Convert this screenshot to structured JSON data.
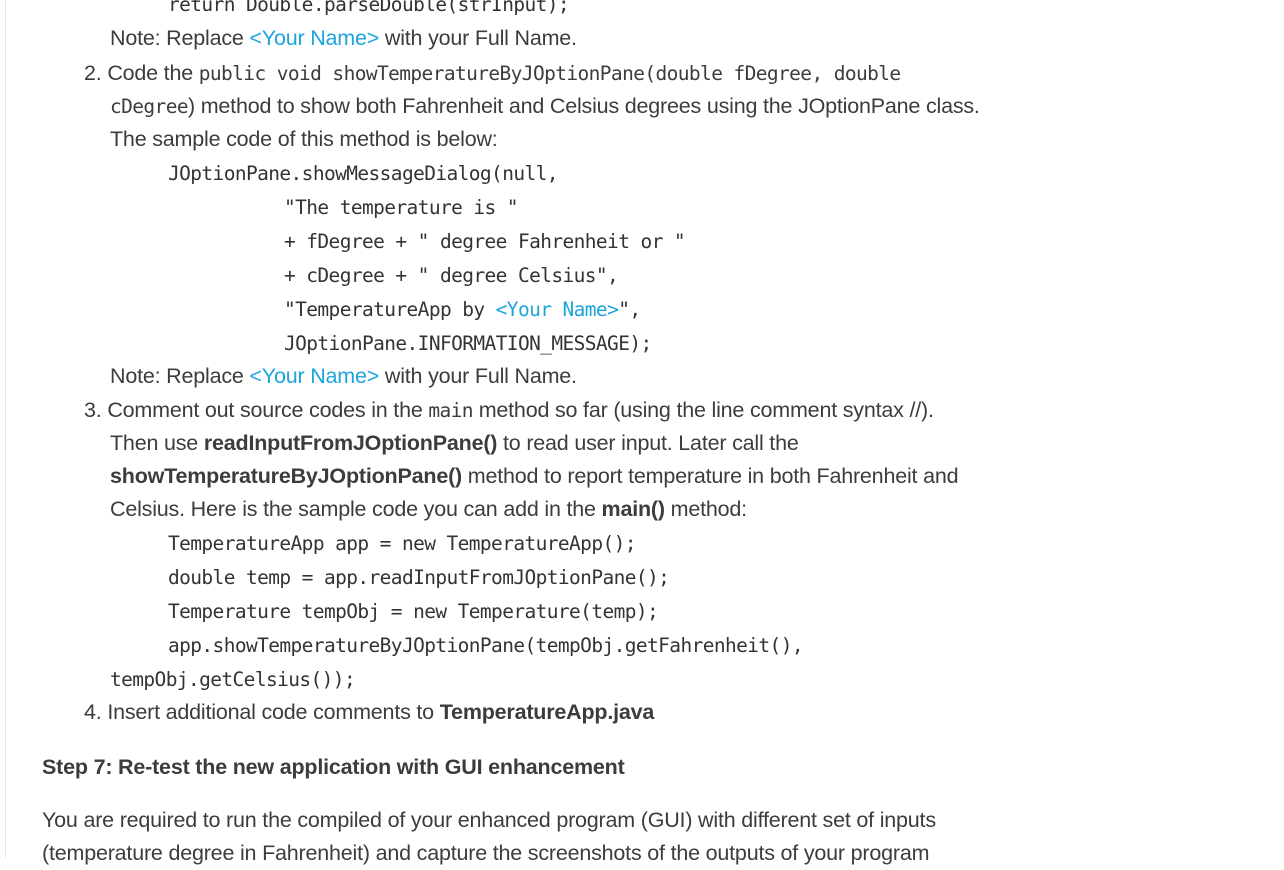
{
  "accent_color": "#1ea4dc",
  "doc": {
    "code_return": "return Double.parseDouble(strInput);",
    "note1": {
      "pre": "Note: Replace ",
      "link": "<Your Name>",
      "post": " with your Full Name."
    },
    "item2": {
      "number": "2.",
      "pre": "Code the ",
      "code1": "public void showTemperatureByJOptionPane(double fDegree, double",
      "code2": "cDegree",
      "post": ") method to show both Fahrenheit and Celsius degrees using the JOptionPane class.",
      "line3": "The sample code of this method is below:"
    },
    "code_block1": {
      "l1": "JOptionPane.showMessageDialog(null,",
      "l2": "\"The temperature is \"",
      "l3": "+ fDegree + \" degree Fahrenheit or \"",
      "l4": "+ cDegree + \" degree Celsius\",",
      "l5_pre": "\"TemperatureApp by ",
      "l5_link": "<Your Name>",
      "l5_post": "\",",
      "l6": "JOptionPane.INFORMATION_MESSAGE);"
    },
    "note2": {
      "pre": "Note: Replace ",
      "link": "<Your Name>",
      "post": " with your Full Name."
    },
    "item3": {
      "number": "3.",
      "l1_pre": "Comment out source codes in the ",
      "l1_code": "main",
      "l1_post": " method so far (using the line comment syntax //).",
      "l2_pre": "Then use ",
      "l2_bold": "readInputFromJOptionPane()",
      "l2_post": " to read user input. Later call the",
      "l3_bold": "showTemperatureByJOptionPane()",
      "l3_post": " method to report temperature in both Fahrenheit and",
      "l4_pre": "Celsius. Here is the sample code you can add in the ",
      "l4_bold": "main()",
      "l4_post": " method:"
    },
    "code_block2": {
      "l1": "TemperatureApp app = new TemperatureApp();",
      "l2": "double temp = app.readInputFromJOptionPane();",
      "l3": "Temperature tempObj = new Temperature(temp);",
      "l4": "app.showTemperatureByJOptionPane(tempObj.getFahrenheit(),",
      "l5": "tempObj.getCelsius());"
    },
    "item4": {
      "number": "4.",
      "pre": "Insert additional code comments to ",
      "bold": "TemperatureApp.java"
    },
    "step7_heading": "Step 7: Re-test the new application with GUI enhancement",
    "step7_p1": "You are required to run the compiled of your enhanced program (GUI) with different set of inputs",
    "step7_p2": "(temperature degree in Fahrenheit) and capture the screenshots of the outputs of your program"
  }
}
